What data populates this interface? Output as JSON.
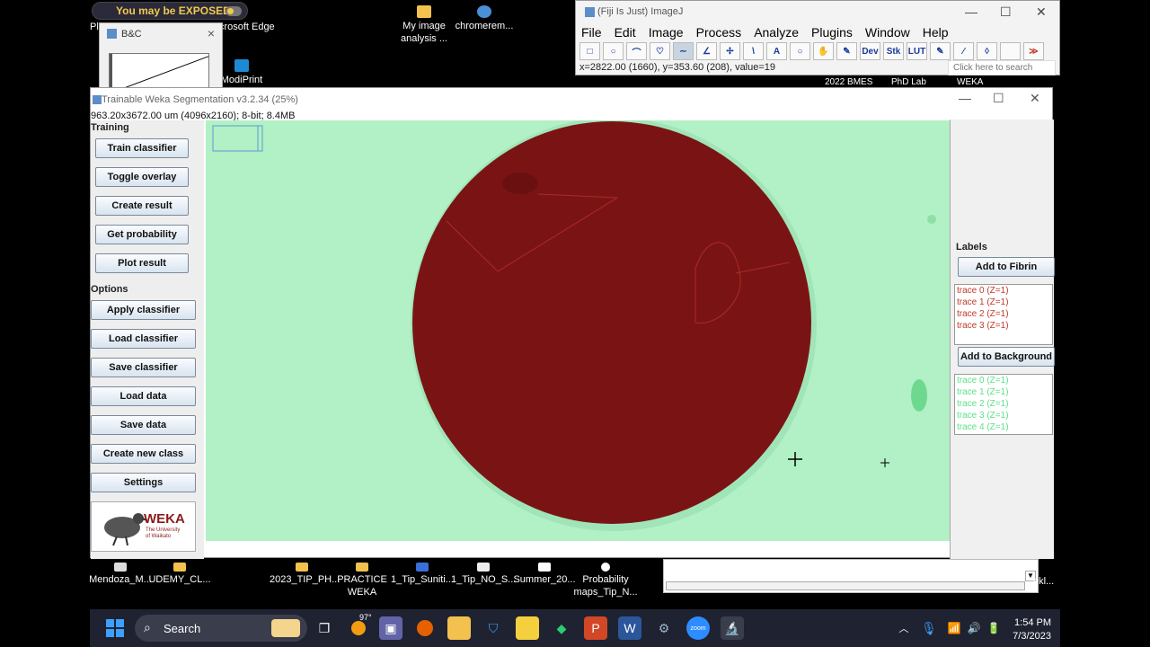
{
  "desktop": {
    "exposed_badge": "You may be EXPOSED!",
    "top_icons": [
      {
        "label": "Pl",
        "name": "pl"
      },
      {
        "label": "Microsoft Edge",
        "name": "microsoft-edge"
      },
      {
        "label": "ModiPrint",
        "name": "modiprint"
      },
      {
        "label": "My image analysis ...",
        "name": "my-image-analysis"
      },
      {
        "label": "chromerem...",
        "name": "chromerem"
      }
    ],
    "labels_above_weka": [
      "2022 BMES",
      "PhD Lab",
      "WEKA"
    ],
    "bottom_icons": [
      {
        "label": "Mendoza_M...",
        "name": "mendoza"
      },
      {
        "label": "UDEMY_CL...",
        "name": "udemy"
      },
      {
        "label": "2023_TIP_PH...",
        "name": "tip-ph"
      },
      {
        "label": "PRACTICE WEKA",
        "name": "practice-weka"
      },
      {
        "label": "1_Tip_Suniti...",
        "name": "tip-suniti"
      },
      {
        "label": "1_Tip_NO_S...",
        "name": "tip-no-s"
      },
      {
        "label": "Summer_20...",
        "name": "summer"
      },
      {
        "label": "Probability maps_Tip_N...",
        "name": "probability-maps"
      },
      {
        "label": "ekl...",
        "name": "ekl"
      }
    ]
  },
  "bc_window": {
    "title": "B&C",
    "close": "×"
  },
  "imagej": {
    "title": "(Fiji Is Just) ImageJ",
    "menu": [
      "File",
      "Edit",
      "Image",
      "Process",
      "Analyze",
      "Plugins",
      "Window",
      "Help"
    ],
    "tools": [
      "□",
      "○",
      "⌒",
      "♡",
      "∼",
      "∠",
      "✢",
      "\\",
      "A",
      "○",
      "✋",
      "✎",
      "Dev",
      "Stk",
      "LUT",
      "✎",
      "⁄",
      "◊",
      "",
      "≫"
    ],
    "status": "x=2822.00 (1660), y=353.60 (208), value=19",
    "search_placeholder": "Click here to search",
    "controls": {
      "minimize": "—",
      "maximize": "☐",
      "close": "✕"
    }
  },
  "weka": {
    "title": "Trainable Weka Segmentation v3.2.34 (25%)",
    "info": "963.20x3672.00 um (4096x2160); 8-bit; 8.4MB",
    "controls": {
      "minimize": "—",
      "maximize": "☐",
      "close": "✕"
    },
    "training_label": "Training",
    "training_buttons": [
      "Train classifier",
      "Toggle overlay",
      "Create result",
      "Get probability",
      "Plot result"
    ],
    "options_label": "Options",
    "options_buttons": [
      "Apply classifier",
      "Load classifier",
      "Save classifier",
      "Load data",
      "Save data",
      "Create new class",
      "Settings"
    ],
    "logo": {
      "word": "WEKA",
      "sub1": "The University",
      "sub2": "of Waikato"
    },
    "labels_title": "Labels",
    "fibrin": {
      "button": "Add to Fibrin",
      "color": "#c0392b",
      "traces": [
        "trace 0 (Z=1)",
        "trace 1 (Z=1)",
        "trace 2 (Z=1)",
        "trace 3 (Z=1)"
      ]
    },
    "background": {
      "button": "Add to Background",
      "color": "#5ee08a",
      "traces": [
        "trace 0 (Z=1)",
        "trace 1 (Z=1)",
        "trace 2 (Z=1)",
        "trace 3 (Z=1)",
        "trace 4 (Z=1)"
      ]
    },
    "overlay_colors": {
      "background": "#b2f0c6",
      "fibrin": "#7a1414"
    }
  },
  "taskbar": {
    "search": "Search",
    "weather": "97°",
    "time": "1:54 PM",
    "date": "7/3/2023",
    "apps": [
      "task-view",
      "weather",
      "teams",
      "firefox",
      "file-explorer",
      "security",
      "sticky-notes",
      "feedback",
      "powerpoint",
      "word",
      "settings",
      "zoom",
      "fiji"
    ]
  }
}
